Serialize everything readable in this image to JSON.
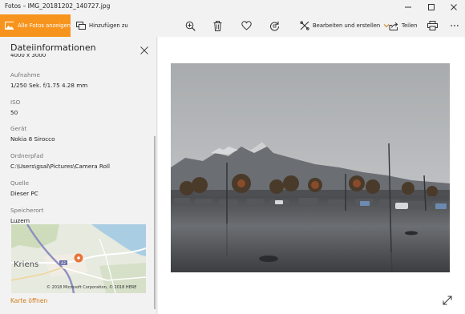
{
  "window": {
    "title": "Fotos – IMG_20181202_140727.jpg",
    "controls": {
      "minimize": "minimize",
      "maximize": "maximize",
      "close": "close"
    }
  },
  "toolbar": {
    "all_photos_label": "Alle Fotos anzeigen",
    "add_to_label": "Hinzufügen zu",
    "edit_label": "Bearbeiten und erstellen",
    "share_label": "Teilen",
    "accent_color": "#f7941d",
    "icons": [
      "zoom-in-icon",
      "delete-icon",
      "heart-icon",
      "rotate-icon",
      "edit-icon",
      "share-icon",
      "print-icon",
      "more-icon"
    ]
  },
  "info_panel": {
    "title": "Dateiinformationen",
    "partial_top_line": "4000 x 3000",
    "fields": [
      {
        "key": "Aufnahme",
        "value": "1/250 Sek. f/1.75 4.28 mm"
      },
      {
        "key": "ISO",
        "value": "50"
      },
      {
        "key": "Gerät",
        "value": "Nokia 8 Sirocco"
      },
      {
        "key": "Ordnerpfad",
        "value": "C:\\Users\\gsal\\Pictures\\Camera Roll"
      },
      {
        "key": "Quelle",
        "value": "Dieser PC"
      },
      {
        "key": "Speicherort",
        "value": "Luzern"
      }
    ],
    "map": {
      "place_label": "Kriens",
      "road_label": "A2",
      "copyright": "© 2018 Microsoft Corporation, © 2018 HERE"
    },
    "open_map_link": "Karte öffnen",
    "link_color": "#d27c16"
  }
}
